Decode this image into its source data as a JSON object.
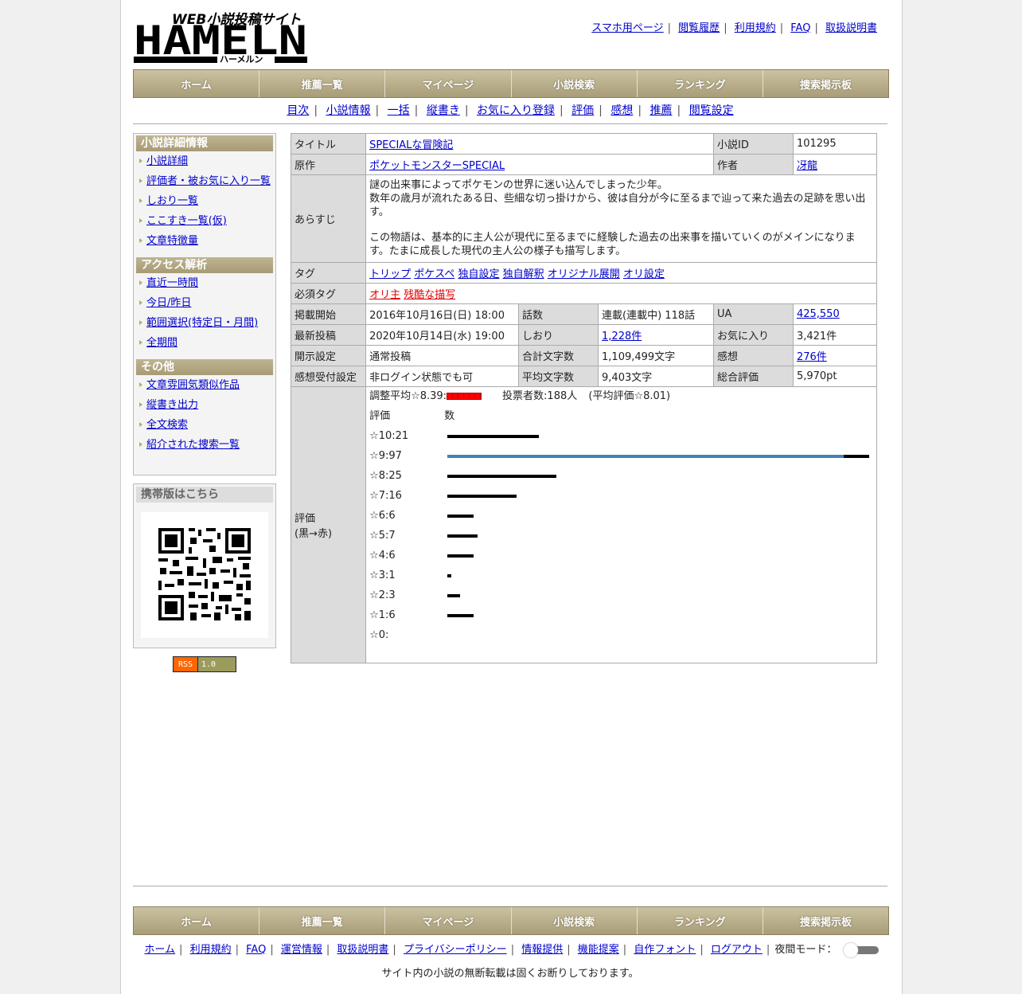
{
  "logo": {
    "top": "WEB小説投稿サイト",
    "main": "HAMELN",
    "kana": "ハーメルン"
  },
  "toplinks": [
    "スマホ用ページ",
    "閲覧履歴",
    "利用規約",
    "FAQ",
    "取扱説明書"
  ],
  "nav": [
    "ホーム",
    "推薦一覧",
    "マイページ",
    "小説検索",
    "ランキング",
    "捜索掲示板"
  ],
  "subnav": [
    "目次",
    "小説情報",
    "一括",
    "縦書き",
    "お気に入り登録",
    "評価",
    "感想",
    "推薦",
    "閲覧設定"
  ],
  "sidebar": {
    "sections": [
      {
        "title": "小説詳細情報",
        "items": [
          "小説詳細",
          "評価者・被お気に入り一覧",
          "しおり一覧",
          "ここすき一覧(仮)",
          "文章特徴量"
        ]
      },
      {
        "title": "アクセス解析",
        "items": [
          "直近一時間",
          "今日/昨日",
          "範囲選択(特定日・月間)",
          "全期間"
        ]
      },
      {
        "title": "その他",
        "items": [
          "文章雰囲気類似作品",
          "縦書き出力",
          "全文検索",
          "紹介された捜索一覧"
        ]
      }
    ],
    "mobile_title": "携帯版はこちら"
  },
  "rss": {
    "left": "RSS",
    "right": "1.0"
  },
  "info": {
    "title_label": "タイトル",
    "title": "SPECIALな冒険記",
    "id_label": "小説ID",
    "id": "101295",
    "original_label": "原作",
    "original": "ポケットモンスターSPECIAL",
    "author_label": "作者",
    "author": "冴龍",
    "synopsis_label": "あらすじ",
    "synopsis_1": "謎の出来事によってポケモンの世界に迷い込んでしまった少年。",
    "synopsis_2": "数年の歳月が流れたある日、些細な切っ掛けから、彼は自分が今に至るまで辿って来た過去の足跡を思い出す。",
    "synopsis_3": "この物語は、基本的に主人公が現代に至るまでに経験した過去の出来事を描いていくのがメインになります。たまに成長した現代の主人公の様子も描写します。",
    "tags_label": "タグ",
    "tags": [
      "トリップ",
      "ポケスペ",
      "独自設定",
      "独自解釈",
      "オリジナル展開",
      "オリ設定"
    ],
    "req_tags_label": "必須タグ",
    "req_tags": [
      "オリ主",
      "残酷な描写"
    ],
    "start_label": "掲載開始",
    "start": "2016年10月16日(日) 18:00",
    "episodes_label": "話数",
    "episodes": "連載(連載中) 118話",
    "ua_label": "UA",
    "ua": "425,550",
    "latest_label": "最新投稿",
    "latest": "2020年10月14日(水) 19:00",
    "bookmark_label": "しおり",
    "bookmark": "1,228件",
    "fav_label": "お気に入り",
    "fav": "3,421件",
    "open_label": "開示設定",
    "open": "通常投稿",
    "chars_label": "合計文字数",
    "chars": "1,109,499文字",
    "review_label": "感想",
    "review": "276件",
    "accept_label": "感想受付設定",
    "accept": "非ログイン状態でも可",
    "avg_chars_label": "平均文字数",
    "avg_chars": "9,403文字",
    "score_label": "総合評価",
    "score": "5,970pt",
    "rating_label": "評価",
    "rating_label2": "(黒→赤)",
    "adjusted": "調整平均☆8.39:",
    "voters": "投票者数:188人",
    "avg": "(平均評価☆8.01)",
    "col_rating": "評価",
    "col_count": "数"
  },
  "vote_chart": {
    "bar_color": "#000000",
    "highlight_color": "#4682b4",
    "rows": [
      {
        "label": "☆10:21",
        "count": 21
      },
      {
        "label": "☆9:97",
        "count": 97
      },
      {
        "label": "☆8:25",
        "count": 25
      },
      {
        "label": "☆7:16",
        "count": 16
      },
      {
        "label": "☆6:6",
        "count": 6
      },
      {
        "label": "☆5:7",
        "count": 7
      },
      {
        "label": "☆4:6",
        "count": 6
      },
      {
        "label": "☆3:1",
        "count": 1
      },
      {
        "label": "☆2:3",
        "count": 3
      },
      {
        "label": "☆1:6",
        "count": 6
      },
      {
        "label": "☆0:",
        "count": 0
      }
    ]
  },
  "footer": {
    "links": [
      "ホーム",
      "利用規約",
      "FAQ",
      "運営情報",
      "取扱説明書",
      "プライバシーポリシー",
      "情報提供",
      "機能提案",
      "自作フォント",
      "ログアウト"
    ],
    "night_mode": "夜間モード：",
    "copyright": "サイト内の小説の無断転載は固くお断りしております。"
  }
}
